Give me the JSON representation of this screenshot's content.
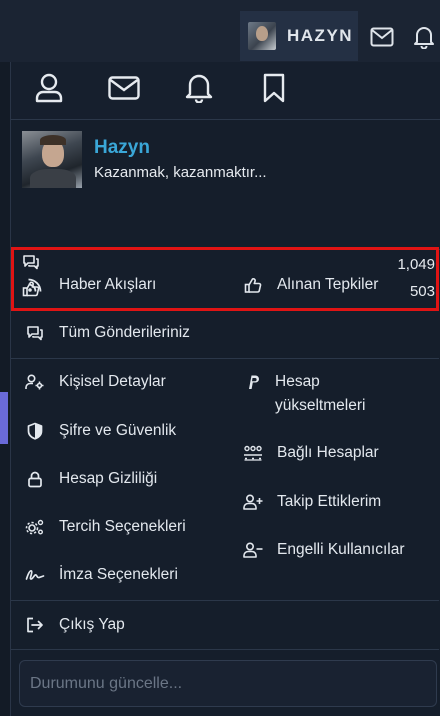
{
  "topbar": {
    "username": "HAZYN",
    "icons": [
      "avatar-icon",
      "mail-icon",
      "bell-icon"
    ]
  },
  "tabs": [
    {
      "name": "profile-icon"
    },
    {
      "name": "mail-icon"
    },
    {
      "name": "bell-icon"
    },
    {
      "name": "bookmark-icon"
    }
  ],
  "profile": {
    "name": "Hazyn",
    "tagline": "Kazanmak, kazanmaktır...",
    "messages_count": "1,049",
    "reactions_count": "503"
  },
  "menu": {
    "news_feed": "Haber Akışları",
    "reactions_received": "Alınan Tepkiler",
    "your_posts": "Tüm Gönderileriniz",
    "account_details": "Kişisel Detaylar",
    "upgrade": "Hesap yükseltmeleri",
    "password_security": "Şifre ve Güvenlik",
    "connected_accounts": "Bağlı Hesaplar",
    "privacy": "Hesap Gizliliği",
    "following": "Takip Ettiklerim",
    "preferences": "Tercih Seçenekleri",
    "ignoring": "Engelli Kullanıcılar",
    "signature": "İmza Seçenekleri",
    "logout": "Çıkış Yap"
  },
  "status": {
    "placeholder": "Durumunu güncelle..."
  },
  "colors": {
    "accent_name": "#3aa7d8",
    "highlight_border": "#e01414"
  }
}
